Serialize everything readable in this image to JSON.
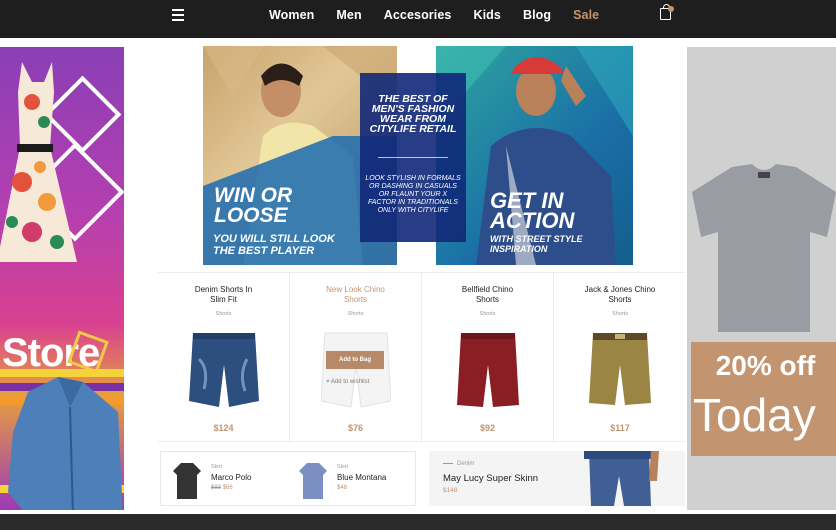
{
  "nav": {
    "items": [
      "Women",
      "Men",
      "Accesories",
      "Kids",
      "Blog"
    ],
    "sale": "Sale"
  },
  "left_banner": {
    "text": "Store"
  },
  "right_banner": {
    "offer": "20% off",
    "today": "Today"
  },
  "hero": {
    "left_title": "WIN OR LOOSE",
    "left_sub": "YOU WILL STILL LOOK THE BEST PLAYER",
    "center_title": "THE BEST OF MEN'S FASHION WEAR FROM CITYLIFE RETAIL",
    "center_sub": "LOOK STYLISH IN FORMALS OR DASHING IN CASUALS OR FLAUNT YOUR X FACTOR IN TRADITIONALS ONLY WITH CITYLIFE",
    "right_title": "GET IN ACTION",
    "right_sub": "WITH STREET STYLE INSPIRATION"
  },
  "products": [
    {
      "name": "Denim Shorts In Slim Fit",
      "category": "Shorts",
      "price": "$124",
      "color": "#2d4f80"
    },
    {
      "name": "New Look Chino Shorts",
      "category": "Shorts",
      "price": "$76",
      "color": "#f7f7f7",
      "add_label": "Add to Bag",
      "wish_label": "Add to wishlist"
    },
    {
      "name": "Bellfield Chino Shorts",
      "category": "Shorts",
      "price": "$92",
      "color": "#8a1e25"
    },
    {
      "name": "Jack & Jones Chino Shorts",
      "category": "Shorts",
      "price": "$117",
      "color": "#9a8545"
    }
  ],
  "mini_products": [
    {
      "category": "Skirt",
      "name": "Marco Polo",
      "old_price": "$83",
      "price": "$66"
    },
    {
      "category": "Skirt",
      "name": "Blue Montana",
      "price": "$48"
    }
  ],
  "feature": {
    "category": "Denim",
    "name": "May Lucy Super Skinn",
    "price": "$148"
  }
}
